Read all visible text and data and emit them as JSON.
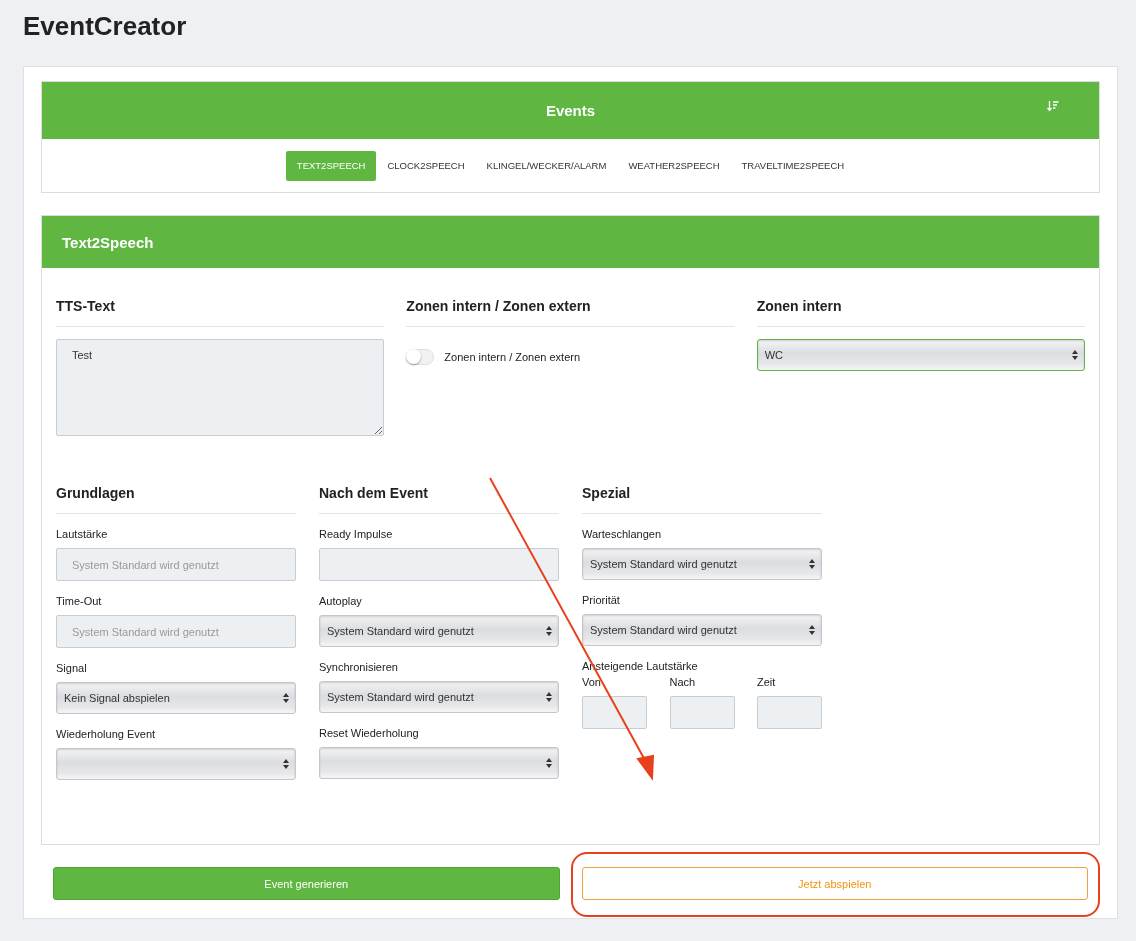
{
  "app_title": "EventCreator",
  "events_panel": {
    "title": "Events",
    "tabs": [
      {
        "label": "TEXT2SPEECH",
        "selected": true
      },
      {
        "label": "CLOCK2SPEECH",
        "selected": false
      },
      {
        "label": "KLINGEL/WECKER/ALARM",
        "selected": false
      },
      {
        "label": "WEATHER2SPEECH",
        "selected": false
      },
      {
        "label": "TRAVELTIME2SPEECH",
        "selected": false
      }
    ]
  },
  "section": {
    "title": "Text2Speech",
    "top_groups": [
      {
        "heading": "TTS-Text",
        "kind": "textarea",
        "value": "Test"
      },
      {
        "heading": "Zonen intern / Zonen extern",
        "kind": "toggle",
        "label": "Zonen intern / Zonen extern",
        "on": false
      },
      {
        "heading": "Zonen intern",
        "kind": "select",
        "value": "WC",
        "focused": true
      }
    ],
    "groups": [
      {
        "heading": "Grundlagen",
        "fields": [
          {
            "label": "Lautstärke",
            "kind": "input",
            "placeholder": "System Standard wird genutzt"
          },
          {
            "label": "Time-Out",
            "kind": "input",
            "placeholder": "System Standard wird genutzt"
          },
          {
            "label": "Signal",
            "kind": "select",
            "value": "Kein Signal abspielen"
          },
          {
            "label": "Wiederholung Event",
            "kind": "select"
          }
        ]
      },
      {
        "heading": "Nach dem Event",
        "fields": [
          {
            "label": "Ready Impulse",
            "kind": "input"
          },
          {
            "label": "Autoplay",
            "kind": "select",
            "value": "System Standard wird genutzt"
          },
          {
            "label": "Synchronisieren",
            "kind": "select",
            "value": "System Standard wird genutzt"
          },
          {
            "label": "Reset Wiederholung",
            "kind": "select"
          }
        ]
      },
      {
        "heading": "Spezial",
        "fields": [
          {
            "label": "Warteschlangen",
            "kind": "select",
            "value": "System Standard wird genutzt"
          },
          {
            "label": "Priorität",
            "kind": "select",
            "value": "System Standard wird genutzt"
          }
        ],
        "ramp": {
          "label": "Ansteigende Lautstärke",
          "fields": [
            {
              "label": "Von"
            },
            {
              "label": "Nach"
            },
            {
              "label": "Zeit"
            }
          ]
        }
      }
    ]
  },
  "buttons": [
    {
      "label": "Event generieren",
      "kind": "primary"
    },
    {
      "label": "Jetzt abspielen",
      "kind": "outline"
    }
  ]
}
